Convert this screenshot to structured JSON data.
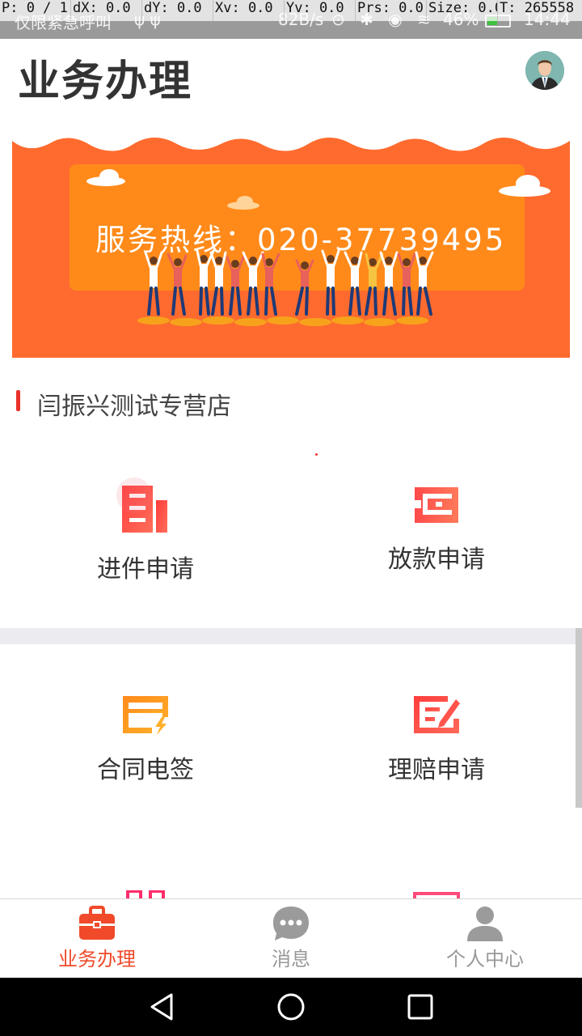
{
  "status_bar": {
    "carrier": "仅限紧急呼叫",
    "usb": "ψ ψ",
    "speed": "82B/s",
    "icons": "⊙ ✱ ◉ ≋",
    "battery_pct": "46%",
    "time": "14:44"
  },
  "dev_overlay": {
    "p": "P: 0 / 1",
    "dx": "dX: 0.0",
    "dy": "dY: 0.0",
    "xv": "Xv: 0.0",
    "yv": "Yv: 0.0",
    "prs": "Prs: 0.0",
    "size": "Size: 0.0",
    "t": "T: 265558"
  },
  "header": {
    "title": "业务办理",
    "avatar_icon": "user-avatar"
  },
  "banner": {
    "text": "服务热线：020-37739495",
    "colors": {
      "background": "#ff6b2e",
      "panel": "#ff8a1a"
    }
  },
  "shop": {
    "name": "闫振兴测试专营店"
  },
  "grid": [
    {
      "label": "进件申请",
      "icon": "application-form-icon"
    },
    {
      "label": "放款申请",
      "icon": "wallet-icon"
    },
    {
      "label": "合同电签",
      "icon": "e-contract-icon"
    },
    {
      "label": "理赔申请",
      "icon": "claim-edit-icon"
    }
  ],
  "bottom_nav": [
    {
      "label": "业务办理",
      "icon": "briefcase-icon",
      "active": true
    },
    {
      "label": "消息",
      "icon": "message-icon",
      "active": false
    },
    {
      "label": "个人中心",
      "icon": "person-icon",
      "active": false
    }
  ],
  "colors": {
    "accent": "#f04a2a",
    "inactive": "#999999"
  }
}
